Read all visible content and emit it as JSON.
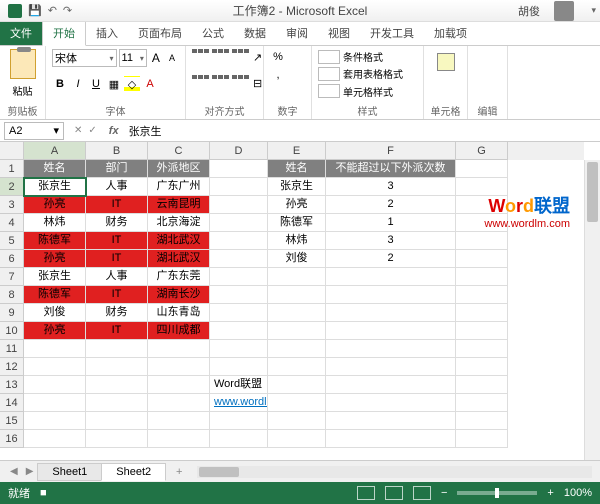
{
  "window": {
    "title": "工作簿2 - Microsoft Excel",
    "user": "胡俊"
  },
  "qat": {
    "save": "💾",
    "undo": "↶",
    "redo": "↷"
  },
  "tabs": {
    "file": "文件",
    "home": "开始",
    "insert": "插入",
    "layout": "页面布局",
    "formulas": "公式",
    "data": "数据",
    "review": "审阅",
    "view": "视图",
    "dev": "开发工具",
    "addin": "加载项"
  },
  "ribbon": {
    "clipboard": {
      "paste": "粘贴",
      "label": "剪贴板"
    },
    "font": {
      "name": "宋体",
      "size": "11",
      "grow": "A",
      "shrink": "A",
      "label": "字体"
    },
    "align": {
      "label": "对齐方式"
    },
    "number": {
      "percent": "%",
      "comma": ",",
      "label": "数字"
    },
    "styles": {
      "cond": "条件格式",
      "table": "套用表格格式",
      "cell": "单元格样式",
      "label": "样式"
    },
    "cells": {
      "label": "单元格"
    },
    "editing": {
      "label": "编辑"
    }
  },
  "namebox": "A2",
  "formula": "张京生",
  "cols": {
    "A": 62,
    "B": 62,
    "C": 62,
    "D": 58,
    "E": 58,
    "F": 130,
    "G": 52
  },
  "table1": {
    "headers": [
      "姓名",
      "部门",
      "外派地区"
    ],
    "rows": [
      {
        "c": [
          "张京生",
          "人事",
          "广东广州"
        ],
        "red": false,
        "sel": true
      },
      {
        "c": [
          "孙亮",
          "IT",
          "云南昆明"
        ],
        "red": true
      },
      {
        "c": [
          "林炜",
          "财务",
          "北京海淀"
        ],
        "red": false
      },
      {
        "c": [
          "陈德军",
          "IT",
          "湖北武汉"
        ],
        "red": true
      },
      {
        "c": [
          "孙亮",
          "IT",
          "湖北武汉"
        ],
        "red": true
      },
      {
        "c": [
          "张京生",
          "人事",
          "广东东莞"
        ],
        "red": false
      },
      {
        "c": [
          "陈德军",
          "IT",
          "湖南长沙"
        ],
        "red": true
      },
      {
        "c": [
          "刘俊",
          "财务",
          "山东青岛"
        ],
        "red": false
      },
      {
        "c": [
          "孙亮",
          "IT",
          "四川成都"
        ],
        "red": true
      }
    ]
  },
  "table2": {
    "headers": [
      "姓名",
      "不能超过以下外派次数"
    ],
    "rows": [
      [
        "张京生",
        "3"
      ],
      [
        "孙亮",
        "2"
      ],
      [
        "陈德军",
        "1"
      ],
      [
        "林炜",
        "3"
      ],
      [
        "刘俊",
        "2"
      ]
    ]
  },
  "note": {
    "t1": "Word联盟",
    "t2": "www.wordlm.com"
  },
  "sheets": {
    "s1": "Sheet1",
    "s2": "Sheet2",
    "add": "+"
  },
  "status": {
    "ready": "就绪",
    "rec": "■",
    "zoom": "100%"
  },
  "watermark": {
    "brand": "Word联盟",
    "url": "www.wordlm.com"
  }
}
